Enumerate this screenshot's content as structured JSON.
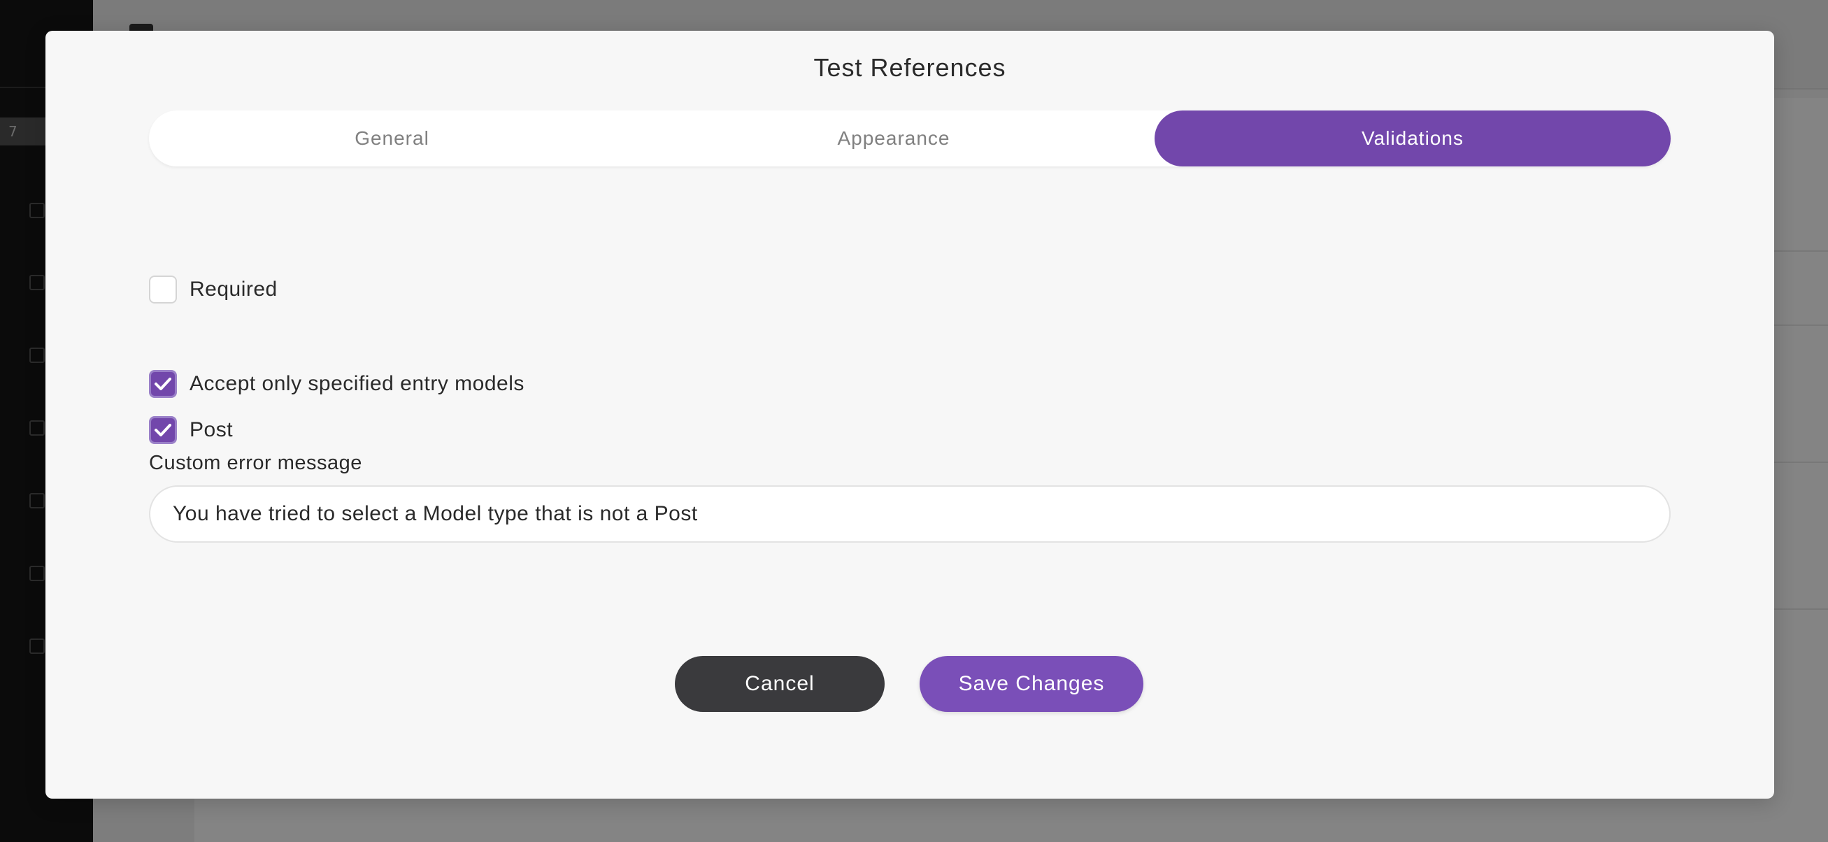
{
  "background": {
    "sidebar_number": "7"
  },
  "modal": {
    "title": "Test References",
    "tabs": [
      {
        "label": "General",
        "active": false
      },
      {
        "label": "Appearance",
        "active": false
      },
      {
        "label": "Validations",
        "active": true
      }
    ],
    "validations": {
      "required": {
        "label": "Required",
        "checked": false
      },
      "accept_only": {
        "label": "Accept only specified entry models",
        "checked": true
      },
      "models": [
        {
          "label": "Post",
          "checked": true
        }
      ],
      "custom_error": {
        "label": "Custom error message",
        "value": "You have tried to select a Model type that is not a Post"
      }
    },
    "buttons": {
      "cancel_label": "Cancel",
      "save_label": "Save Changes"
    }
  },
  "colors": {
    "accent": "#7247ab",
    "cancel_button": "#3a3a3d",
    "modal_background": "#f7f7f7",
    "overlay": "#7f7f7f"
  }
}
